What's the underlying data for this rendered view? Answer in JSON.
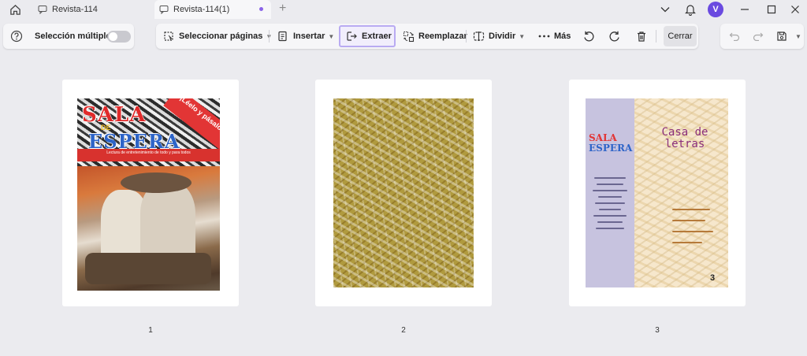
{
  "tabs": [
    {
      "label": "Revista-114"
    },
    {
      "label": "Revista-114(1)"
    }
  ],
  "user": {
    "initial": "V"
  },
  "toolbar": {
    "multi_select_label": "Selección múltiple",
    "select_pages_label": "Seleccionar páginas",
    "insert_label": "Insertar",
    "extract_label": "Extraer",
    "replace_label": "Reemplazar",
    "split_label": "Dividir",
    "more_label": "Más",
    "close_label": "Cerrar"
  },
  "pages": [
    {
      "number": "1"
    },
    {
      "number": "2"
    },
    {
      "number": "3"
    }
  ],
  "page1": {
    "title_a": "SALA",
    "title_de": "DE",
    "title_b": "ESPERA",
    "ribbon": "¡Léelo y pásalo!",
    "band": "Lectura de entretenimiento de todo y para todos"
  },
  "page3": {
    "title": "Casa de letras",
    "page_no": "3"
  },
  "colors": {
    "accent": "#6a4ae0",
    "highlight_border": "#b9abf2"
  }
}
